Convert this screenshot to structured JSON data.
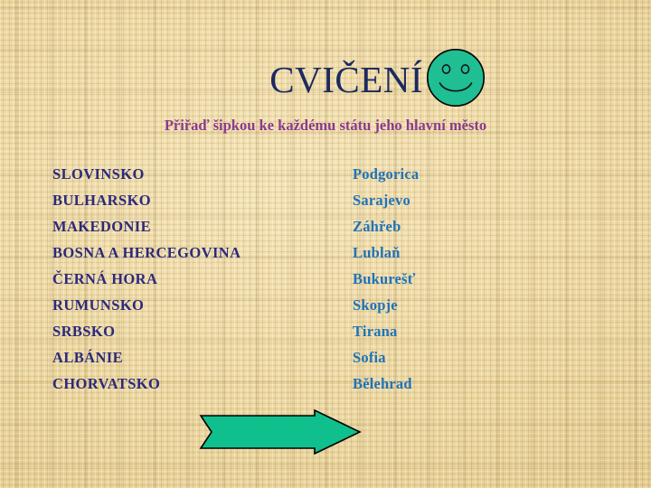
{
  "slide": {
    "title": "CVIČENÍ",
    "subtitle": "Přiřaď šipkou ke každému státu jeho hlavní město",
    "background_color": "#ecd79f",
    "title_color": "#1c2a60",
    "subtitle_color": "#8a3b8e"
  },
  "smiley": {
    "icon": "smiley-face-icon",
    "fill_color": "#1fbe93",
    "outline_color": "#000000"
  },
  "countries": {
    "heading": "",
    "text_color": "#2b2a7c",
    "items": [
      {
        "label": "SLOVINSKO"
      },
      {
        "label": "BULHARSKO"
      },
      {
        "label": "MAKEDONIE"
      },
      {
        "label": "BOSNA A HERCEGOVINA"
      },
      {
        "label": "ČERNÁ HORA"
      },
      {
        "label": "RUMUNSKO"
      },
      {
        "label": "SRBSKO"
      },
      {
        "label": "ALBÁNIE"
      },
      {
        "label": "CHORVATSKO"
      }
    ]
  },
  "capitals": {
    "heading": "",
    "text_color": "#1f73b9",
    "items": [
      {
        "label": "Podgorica"
      },
      {
        "label": "Sarajevo"
      },
      {
        "label": "Záhřeb"
      },
      {
        "label": "Lublaň"
      },
      {
        "label": "Bukurešť"
      },
      {
        "label": "Skopje"
      },
      {
        "label": "Tirana"
      },
      {
        "label": "Sofia"
      },
      {
        "label": "Bělehrad"
      }
    ]
  },
  "arrow": {
    "icon": "right-arrow-icon",
    "fill_color": "#0fc08d",
    "outline_color": "#000000",
    "direction": "right"
  }
}
